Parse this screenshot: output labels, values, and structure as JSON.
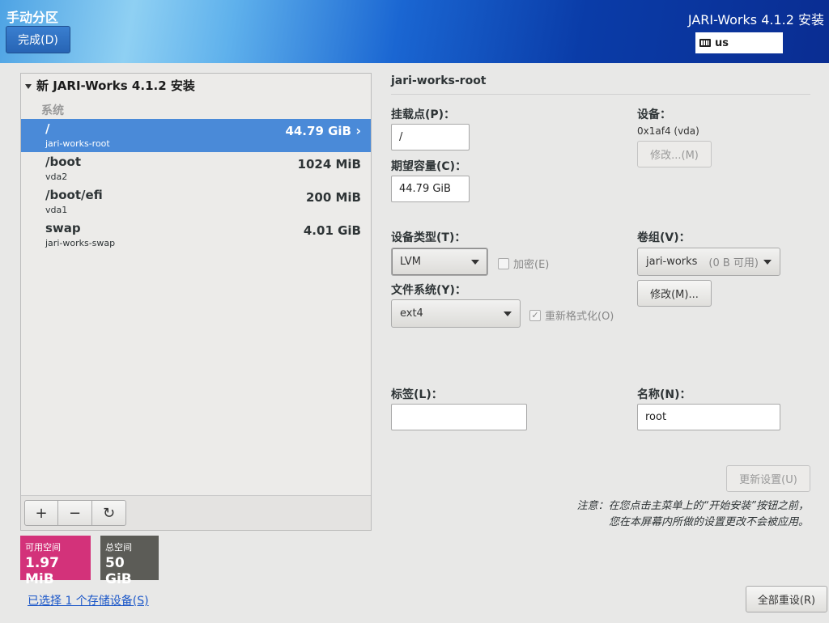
{
  "header": {
    "spoke_title": "手动分区",
    "done_label": "完成(D)",
    "product_title": "JARI-Works 4.1.2 安装",
    "keyboard_layout": "us"
  },
  "partitions": {
    "install_title": "新 JARI-Works 4.1.2 安装",
    "section_label": "系统",
    "rows": [
      {
        "mount": "/",
        "device": "jari-works-root",
        "size": "44.79 GiB",
        "selected": true
      },
      {
        "mount": "/boot",
        "device": "vda2",
        "size": "1024 MiB",
        "selected": false
      },
      {
        "mount": "/boot/efi",
        "device": "vda1",
        "size": "200 MiB",
        "selected": false
      },
      {
        "mount": "swap",
        "device": "jari-works-swap",
        "size": "4.01 GiB",
        "selected": false
      }
    ],
    "toolbar": {
      "add": "+",
      "remove": "−",
      "refresh": "↻"
    }
  },
  "space": {
    "available_label": "可用空间",
    "available_value": "1.97 MiB",
    "total_label": "总空间",
    "total_value": "50 GiB"
  },
  "storage_link": "已选择 1 个存储设备(S)",
  "detail": {
    "title": "jari-works-root",
    "mount_point_label": "挂载点(P)：",
    "mount_point_value": "/",
    "capacity_label": "期望容量(C)：",
    "capacity_value": "44.79 GiB",
    "device_label": "设备：",
    "device_value": "0x1af4 (vda)",
    "device_modify": "修改...(M)",
    "device_type_label": "设备类型(T)：",
    "device_type_value": "LVM",
    "encrypt_label": "加密(E)",
    "filesystem_label": "文件系统(Y)：",
    "filesystem_value": "ext4",
    "reformat_label": "重新格式化(O)",
    "volume_group_label": "卷组(V)：",
    "volume_group_value": "jari-works",
    "volume_group_free": "(0 B 可用)",
    "volume_group_modify": "修改(M)...",
    "tag_label": "标签(L)：",
    "tag_value": "",
    "name_label": "名称(N)：",
    "name_value": "root",
    "update_button": "更新设置(U)",
    "note_line1": "注意：在您点击主菜单上的“开始安装”按钮之前，",
    "note_line2": "您在本屏幕内所做的设置更改不会被应用。"
  },
  "reset_all": "全部重设(R)",
  "colors": {
    "selected_row": "#4a8ad8",
    "available_space": "#d3327a",
    "total_space": "#5c5c57",
    "link": "#1a56c8"
  }
}
